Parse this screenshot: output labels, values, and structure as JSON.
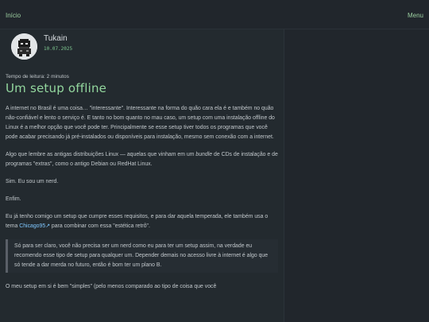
{
  "nav": {
    "home_label": "Início",
    "menu_label": "Menu"
  },
  "author": {
    "name": "Tukain",
    "date": "10.07.2025"
  },
  "article": {
    "read_time": "Tempo de leitura: 2 minutos",
    "title": "Um setup offline",
    "p1": "A internet no Brasil é uma coisa… \"interessante\". Interessante na forma do quão cara ela é e também no quão não-confiável e lento o serviço é. E tanto no bom quanto no mau caso, um setup com uma instalação offline do Linux é a melhor opção que você pode ter. Principalmente se esse setup tiver todos os programas que você pode acabar precisando já pré-instalados ou disponíveis para instalação, mesmo sem conexão com a internet.",
    "p2_before": "Algo que lembre as antigas distribuições Linux — aquelas que vinham em um ",
    "p2_italic": "bundle",
    "p2_after": " de CDs de instalação e de programas \"extras\", como o antigo Debian ou RedHat Linux.",
    "p3": "Sim. Eu sou um nerd.",
    "p4": "Enfim.",
    "p5_before": "Eu já tenho comigo um setup que cumpre esses requisitos, e para dar aquela temperada, ele também usa o tema ",
    "p5_link": "Chicago95",
    "p5_link_suffix": "↗",
    "p5_after": " para combinar com essa \"estética retrô\".",
    "quote": "Só para ser claro, você não precisa ser um nerd como eu para ter um setup assim, na verdade eu recomendo esse tipo de setup para qualquer um. Depender demais no acesso livre à internet é algo que só tende a dar merda no futuro, então é bom ter um plano B.",
    "p6": "O meu setup em si é bem \"simples\" (pelo menos comparado ao tipo de coisa que você"
  },
  "colors": {
    "background": "#21262c",
    "accent_green": "#93d79e",
    "link_blue": "#7fc7ff"
  },
  "icons": {
    "avatar": "pixel-character-avatar"
  }
}
